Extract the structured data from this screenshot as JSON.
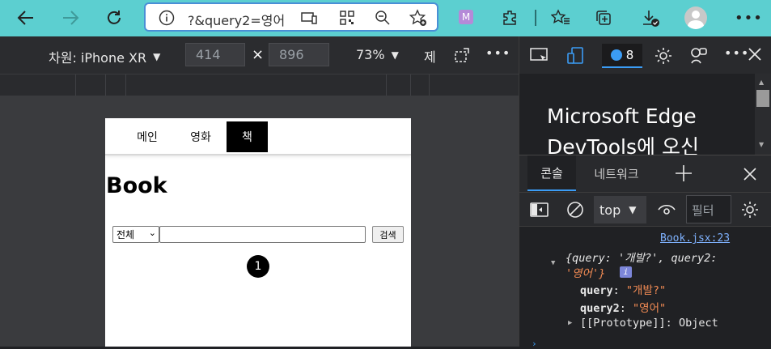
{
  "browser": {
    "address_text": "?&query2=영어",
    "badge_count": "8"
  },
  "device_toolbar": {
    "device_label": "차원: iPhone XR",
    "width": "414",
    "times": "×",
    "height": "896",
    "zoom": "73%",
    "throttle_label": "제"
  },
  "app": {
    "nav": [
      "메인",
      "영화",
      "책"
    ],
    "active_tab": "책",
    "heading": "Book",
    "filter_select": "전체",
    "search_value": "",
    "search_button": "검색",
    "current_page": "1"
  },
  "devtools": {
    "preview_text": "Microsoft Edge DevTools에 오신",
    "tabs": [
      "콘솔",
      "네트워크"
    ],
    "context": "top",
    "filter_placeholder": "필터",
    "log_source": "Book.jsx:23",
    "log_summary_1": "{query: '개발?', query2:",
    "log_summary_2": "'영어'}",
    "prop1_key": "query",
    "prop1_val": "\"개발?\"",
    "prop2_key": "query2",
    "prop2_val": "\"영어\"",
    "proto_key": "[[Prototype]]",
    "proto_val": "Object"
  },
  "colors": {
    "chrome_bar": "#5ccfd0",
    "devtools_bg": "#202124",
    "accent_blue": "#3b9cf5"
  }
}
